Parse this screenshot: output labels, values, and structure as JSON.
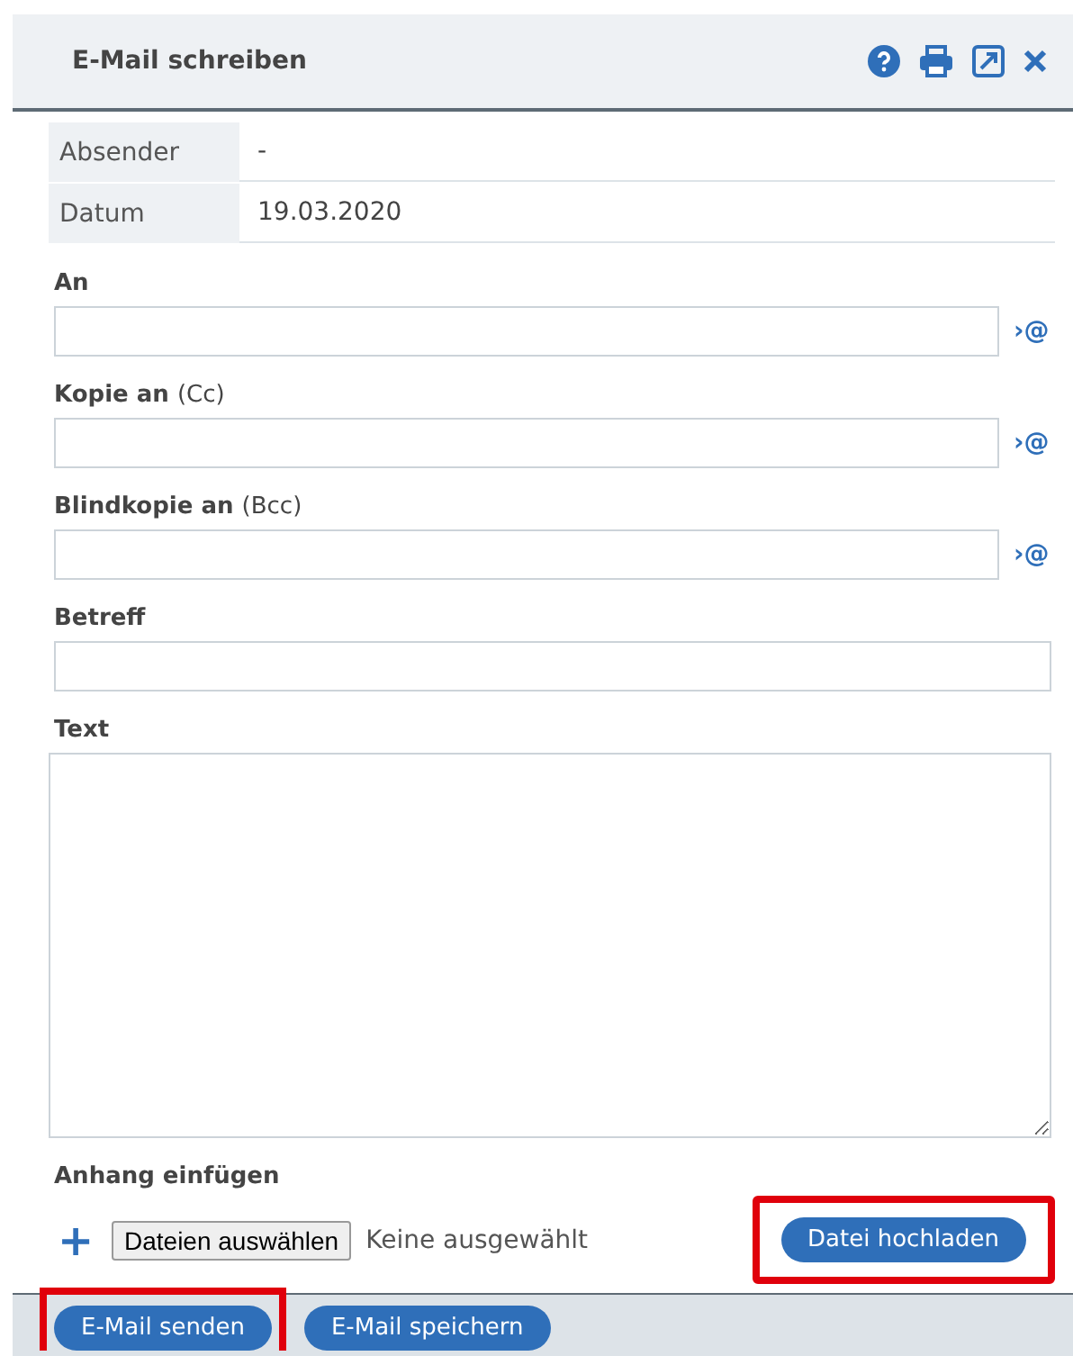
{
  "window": {
    "title": "E-Mail schreiben",
    "tools": [
      {
        "kind": "help"
      },
      {
        "kind": "print"
      },
      {
        "kind": "popout"
      },
      {
        "kind": "close"
      }
    ]
  },
  "info": [
    {
      "label": "Absender",
      "value": "-"
    },
    {
      "label": "Datum",
      "value": "19.03.2020"
    }
  ],
  "fields": [
    {
      "label": "An",
      "address_book": true,
      "addr_label": "›@"
    },
    {
      "label": "Kopie an",
      "hint": "(Cc)",
      "address_book": true,
      "addr_label": "›@"
    },
    {
      "label": "Blindkopie an",
      "hint": "(Bcc)",
      "address_book": true,
      "addr_label": "›@"
    },
    {
      "label": "Betreff",
      "address_book": false
    }
  ],
  "text": {
    "label": "Text"
  },
  "attachment": {
    "label": "Anhang einfügen",
    "add": "+",
    "choose": "Dateien auswählen",
    "status": "Keine ausgewählt",
    "upload": {
      "label": "Datei hochladen",
      "highlighted": true
    }
  },
  "footer": [
    {
      "label": "E-Mail senden",
      "highlighted": true
    },
    {
      "label": "E-Mail speichern",
      "highlighted": false
    }
  ]
}
